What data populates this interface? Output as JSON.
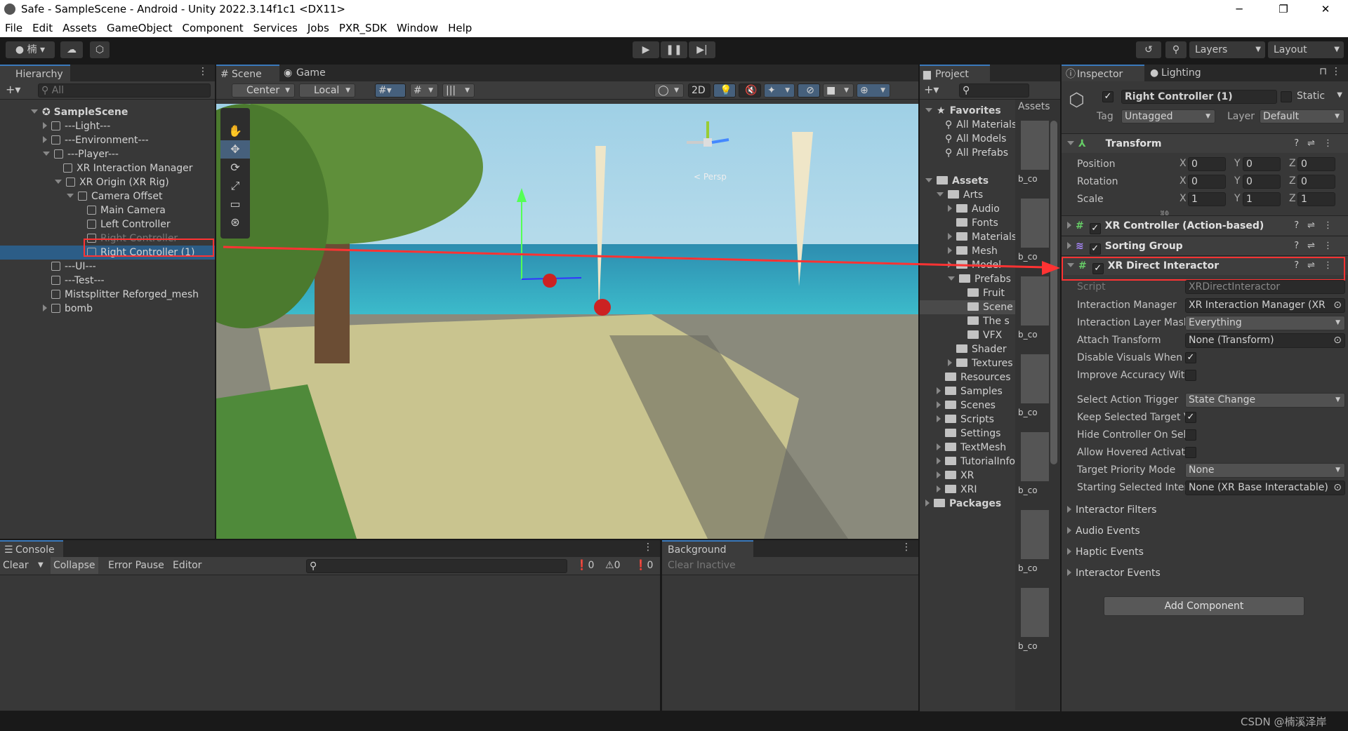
{
  "window": {
    "title": "Safe - SampleScene - Android - Unity 2022.3.14f1c1 <DX11>",
    "minimize": "─",
    "maximize": "❐",
    "close": "✕"
  },
  "menu": [
    "File",
    "Edit",
    "Assets",
    "GameObject",
    "Component",
    "Services",
    "Jobs",
    "PXR_SDK",
    "Window",
    "Help"
  ],
  "toolbar": {
    "account": "楠",
    "layers": "Layers",
    "layout": "Layout"
  },
  "hierarchy": {
    "tab": "Hierarchy",
    "search_placeholder": "All",
    "scene": "SampleScene",
    "items": [
      {
        "label": "---Light---",
        "depth": 1,
        "arrow": "closed"
      },
      {
        "label": "---Environment---",
        "depth": 1,
        "arrow": "closed"
      },
      {
        "label": "---Player---",
        "depth": 1,
        "arrow": "open"
      },
      {
        "label": "XR Interaction Manager",
        "depth": 2,
        "arrow": "none"
      },
      {
        "label": "XR Origin (XR Rig)",
        "depth": 2,
        "arrow": "open"
      },
      {
        "label": "Camera Offset",
        "depth": 3,
        "arrow": "open"
      },
      {
        "label": "Main Camera",
        "depth": 4,
        "arrow": "none"
      },
      {
        "label": "Left Controller",
        "depth": 4,
        "arrow": "none"
      },
      {
        "label": "Right Controller",
        "depth": 4,
        "arrow": "none",
        "disabled": true
      },
      {
        "label": "Right Controller (1)",
        "depth": 4,
        "arrow": "none",
        "selected": true
      },
      {
        "label": "---UI---",
        "depth": 1,
        "arrow": "none"
      },
      {
        "label": "---Test---",
        "depth": 1,
        "arrow": "none"
      },
      {
        "label": "Mistsplitter Reforged_mesh",
        "depth": 1,
        "arrow": "none"
      },
      {
        "label": "bomb",
        "depth": 1,
        "arrow": "closed"
      }
    ]
  },
  "scene": {
    "tabs": [
      "Scene",
      "Game"
    ],
    "pivot": "Center",
    "space": "Local",
    "mode2d": "2D",
    "gizmo_label": "< Persp"
  },
  "project": {
    "tab": "Project",
    "assets_header": "Assets",
    "tree": [
      {
        "label": "Favorites",
        "depth": 0,
        "arrow": "open",
        "bold": true,
        "icon": "star"
      },
      {
        "label": "All Materials",
        "depth": 1,
        "arrow": "none",
        "icon": "search"
      },
      {
        "label": "All Models",
        "depth": 1,
        "arrow": "none",
        "icon": "search"
      },
      {
        "label": "All Prefabs",
        "depth": 1,
        "arrow": "none",
        "icon": "search"
      },
      {
        "label": "",
        "depth": 0,
        "arrow": "none",
        "icon": "none"
      },
      {
        "label": "Assets",
        "depth": 0,
        "arrow": "open",
        "bold": true,
        "icon": "folder"
      },
      {
        "label": "Arts",
        "depth": 1,
        "arrow": "open",
        "icon": "folder"
      },
      {
        "label": "Audio",
        "depth": 2,
        "arrow": "closed",
        "icon": "folder"
      },
      {
        "label": "Fonts",
        "depth": 2,
        "arrow": "none",
        "icon": "folder"
      },
      {
        "label": "Materials",
        "depth": 2,
        "arrow": "closed",
        "icon": "folder"
      },
      {
        "label": "Mesh",
        "depth": 2,
        "arrow": "closed",
        "icon": "folder"
      },
      {
        "label": "Model",
        "depth": 2,
        "arrow": "closed",
        "icon": "folder"
      },
      {
        "label": "Prefabs",
        "depth": 2,
        "arrow": "open",
        "icon": "folder"
      },
      {
        "label": "Fruit",
        "depth": 3,
        "arrow": "none",
        "icon": "folder"
      },
      {
        "label": "Scene",
        "depth": 3,
        "arrow": "none",
        "icon": "folder",
        "selected": true
      },
      {
        "label": "The s",
        "depth": 3,
        "arrow": "none",
        "icon": "folder"
      },
      {
        "label": "VFX",
        "depth": 3,
        "arrow": "none",
        "icon": "folder"
      },
      {
        "label": "Shader",
        "depth": 2,
        "arrow": "none",
        "icon": "folder"
      },
      {
        "label": "Textures",
        "depth": 2,
        "arrow": "closed",
        "icon": "folder"
      },
      {
        "label": "Resources",
        "depth": 1,
        "arrow": "none",
        "icon": "folder"
      },
      {
        "label": "Samples",
        "depth": 1,
        "arrow": "closed",
        "icon": "folder"
      },
      {
        "label": "Scenes",
        "depth": 1,
        "arrow": "closed",
        "icon": "folder"
      },
      {
        "label": "Scripts",
        "depth": 1,
        "arrow": "closed",
        "icon": "folder"
      },
      {
        "label": "Settings",
        "depth": 1,
        "arrow": "none",
        "icon": "folder"
      },
      {
        "label": "TextMesh",
        "depth": 1,
        "arrow": "closed",
        "icon": "folder"
      },
      {
        "label": "TutorialInfo",
        "depth": 1,
        "arrow": "closed",
        "icon": "folder"
      },
      {
        "label": "XR",
        "depth": 1,
        "arrow": "closed",
        "icon": "folder"
      },
      {
        "label": "XRI",
        "depth": 1,
        "arrow": "closed",
        "icon": "folder"
      },
      {
        "label": "Packages",
        "depth": 0,
        "arrow": "closed",
        "bold": true,
        "icon": "folder"
      }
    ],
    "thumbs": [
      "b_co",
      "b_co",
      "b_co",
      "b_co",
      "b_co",
      "b_co",
      "b_co"
    ]
  },
  "inspector": {
    "tabs": [
      "Inspector",
      "Lighting"
    ],
    "object_name": "Right Controller (1)",
    "active": true,
    "static_label": "Static",
    "tag_label": "Tag",
    "tag": "Untagged",
    "layer_label": "Layer",
    "layer": "Default",
    "transform": {
      "title": "Transform",
      "rows": [
        {
          "label": "Position",
          "x": "0",
          "y": "0",
          "z": "0"
        },
        {
          "label": "Rotation",
          "x": "0",
          "y": "0",
          "z": "0"
        },
        {
          "label": "Scale",
          "x": "1",
          "y": "1",
          "z": "1"
        }
      ]
    },
    "components": [
      {
        "title": "XR Controller (Action-based)",
        "enabled": true
      },
      {
        "title": "Sorting Group",
        "enabled": true
      }
    ],
    "direct": {
      "title": "XR Direct Interactor",
      "enabled": true,
      "script_label": "Script",
      "script": "XRDirectInteractor",
      "fields": [
        {
          "label": "Interaction Manager",
          "type": "object",
          "value": "XR Interaction Manager (XR"
        },
        {
          "label": "Interaction Layer Mask",
          "type": "dropdown",
          "value": "Everything"
        },
        {
          "label": "Attach Transform",
          "type": "object",
          "value": "None (Transform)"
        },
        {
          "label": "Disable Visuals When Blocked",
          "type": "check",
          "checked": true
        },
        {
          "label": "Improve Accuracy With Sphere",
          "type": "check",
          "checked": false
        },
        {
          "label": "Select Action Trigger",
          "type": "dropdown",
          "value": "State Change",
          "gap": true
        },
        {
          "label": "Keep Selected Target Valid",
          "type": "check",
          "checked": true
        },
        {
          "label": "Hide Controller On Select",
          "type": "check",
          "checked": false
        },
        {
          "label": "Allow Hovered Activate",
          "type": "check",
          "checked": false
        },
        {
          "label": "Target Priority Mode",
          "type": "dropdown",
          "value": "None"
        },
        {
          "label": "Starting Selected Interactable",
          "type": "object",
          "value": "None (XR Base Interactable)"
        }
      ],
      "foldouts": [
        "Interactor Filters",
        "Audio Events",
        "Haptic Events",
        "Interactor Events"
      ]
    },
    "add_component": "Add Component"
  },
  "console": {
    "tab": "Console",
    "clear": "Clear",
    "collapse": "Collapse",
    "error_pause": "Error Pause",
    "editor": "Editor",
    "info_count": "0",
    "warn_count": "0",
    "error_count": "0"
  },
  "background_tasks": {
    "tab": "Background Tasks",
    "clear_inactive": "Clear Inactive"
  },
  "watermark": "CSDN @楠溪泽岸",
  "colors": {
    "selection": "#2c5d87",
    "highlight": "#ff3333",
    "accent": "#3a79bb"
  }
}
